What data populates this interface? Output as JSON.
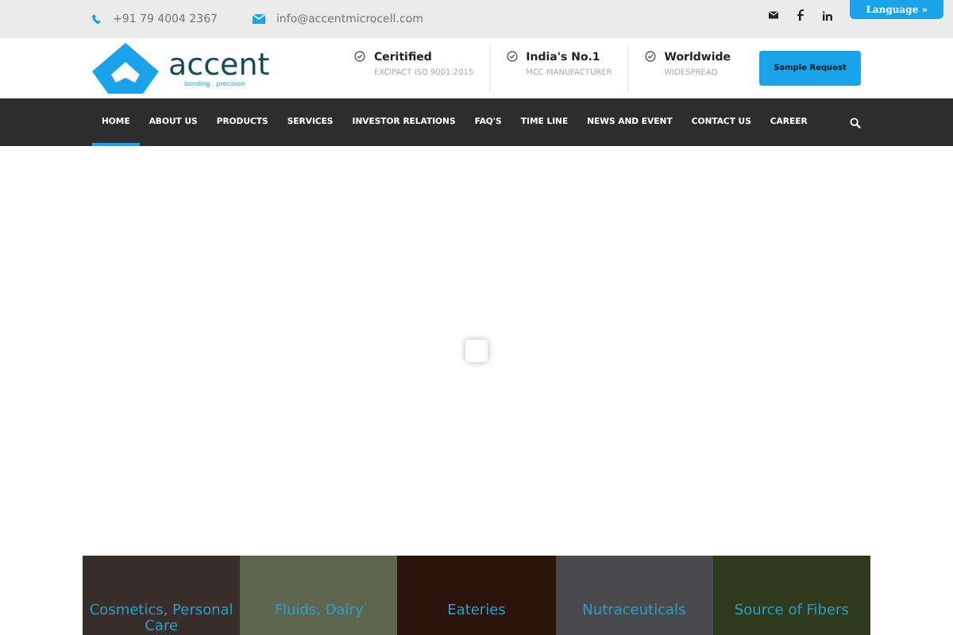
{
  "topbar": {
    "phone": "+91 79 4004 2367",
    "email": "info@accentmicrocell.com",
    "language_button": "Language »"
  },
  "logo": {
    "name": "accent",
    "tagline": "bonding . precision"
  },
  "highlights": [
    {
      "title": "Ceritified",
      "subtitle": "EXCIPACT ISO 9001:2015"
    },
    {
      "title": "India's No.1",
      "subtitle": "MCC MANUFACTURER"
    },
    {
      "title": "Worldwide",
      "subtitle": "WIDESPREAD"
    }
  ],
  "cta_button": "Sample Request",
  "nav": [
    {
      "label": "HOME",
      "selected": true
    },
    {
      "label": "ABOUT US",
      "selected": false
    },
    {
      "label": "PRODUCTS",
      "selected": false
    },
    {
      "label": "SERVICES",
      "selected": false
    },
    {
      "label": "INVESTOR RELATIONS",
      "selected": false
    },
    {
      "label": "FAQ'S",
      "selected": false
    },
    {
      "label": "TIME LINE",
      "selected": false
    },
    {
      "label": "NEWS AND EVENT",
      "selected": false
    },
    {
      "label": "CONTACT US",
      "selected": false
    },
    {
      "label": "CAREER",
      "selected": false
    }
  ],
  "categories": [
    {
      "label": "Cosmetics, Personal Care",
      "color": "#3a2e2a"
    },
    {
      "label": "Fluids, Dairy",
      "color": "#5f6650"
    },
    {
      "label": "Eateries",
      "color": "#2a140c"
    },
    {
      "label": "Nutraceuticals",
      "color": "#4a4a4c"
    },
    {
      "label": "Source of Fibers",
      "color": "#2f3a1c"
    }
  ]
}
